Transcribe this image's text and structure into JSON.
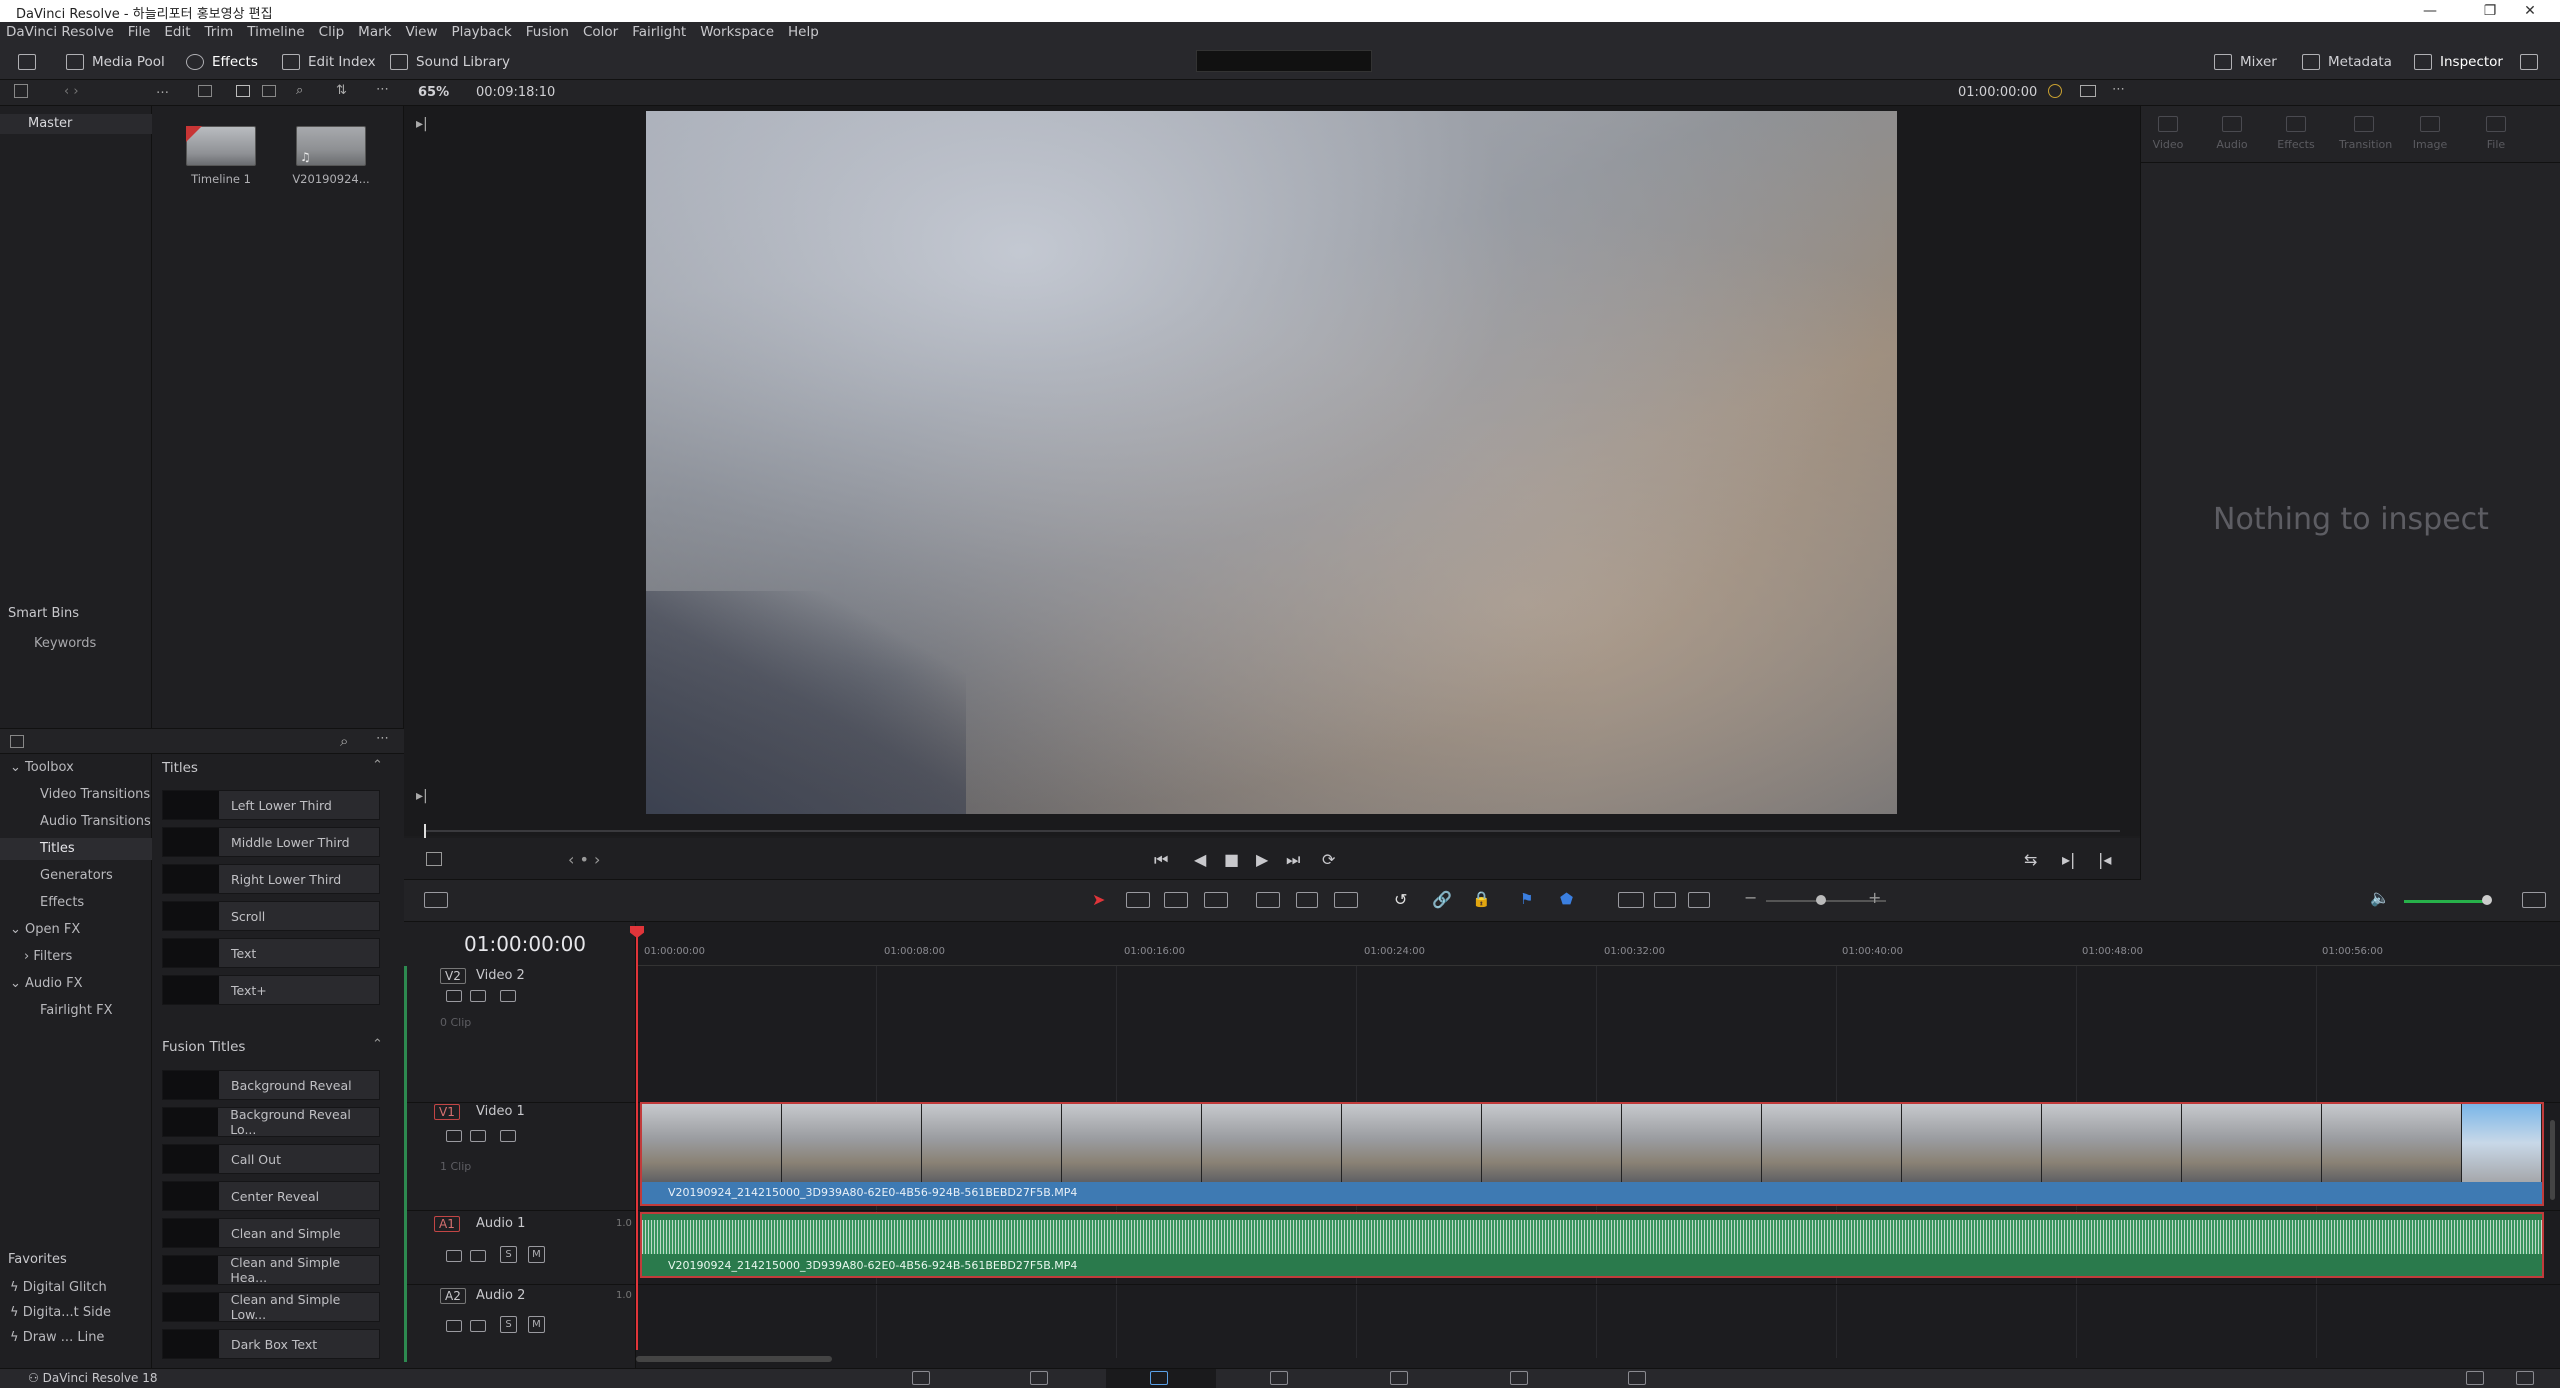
{
  "window": {
    "title": "DaVinci Resolve - 하늘리포터 홍보영상 편집",
    "minimize": "—",
    "maximize": "❐",
    "close": "✕"
  },
  "menu": [
    "DaVinci Resolve",
    "File",
    "Edit",
    "Trim",
    "Timeline",
    "Clip",
    "Mark",
    "View",
    "Playback",
    "Fusion",
    "Color",
    "Fairlight",
    "Workspace",
    "Help"
  ],
  "toolbar": {
    "media_pool": "Media Pool",
    "effects": "Effects",
    "edit_index": "Edit Index",
    "sound_library": "Sound Library",
    "mixer": "Mixer",
    "metadata": "Metadata",
    "inspector": "Inspector"
  },
  "subbar": {
    "zoom": "65%",
    "source_tc": "00:09:18:10",
    "record_tc": "01:00:00:00"
  },
  "bins": {
    "master": "Master",
    "smart_bins": "Smart Bins",
    "keywords": "Keywords"
  },
  "media": [
    {
      "label": "Timeline 1"
    },
    {
      "label": "V20190924..."
    }
  ],
  "effects_tree": {
    "toolbox": "Toolbox",
    "video_transitions": "Video Transitions",
    "audio_transitions": "Audio Transitions",
    "titles": "Titles",
    "generators": "Generators",
    "effects": "Effects",
    "open_fx": "Open FX",
    "filters": "Filters",
    "audio_fx": "Audio FX",
    "fairlight_fx": "Fairlight FX"
  },
  "titles_section": "Titles",
  "titles": [
    "Left Lower Third",
    "Middle Lower Third",
    "Right Lower Third",
    "Scroll",
    "Text",
    "Text+"
  ],
  "fusion_section": "Fusion Titles",
  "fusion_titles": [
    "Background Reveal",
    "Background Reveal Lo...",
    "Call Out",
    "Center Reveal",
    "Clean and Simple",
    "Clean and Simple Hea...",
    "Clean and Simple Low...",
    "Dark Box Text"
  ],
  "favorites": {
    "header": "Favorites",
    "items": [
      "Digital Glitch",
      "Digita...t Side",
      "Draw ... Line"
    ]
  },
  "inspector": {
    "tabs": [
      "Video",
      "Audio",
      "Effects",
      "Transition",
      "Image",
      "File"
    ],
    "empty_message": "Nothing to inspect"
  },
  "timeline": {
    "timecode": "01:00:00:00",
    "ruler": [
      "01:00:00:00",
      "01:00:08:00",
      "01:00:16:00",
      "01:00:24:00",
      "01:00:32:00",
      "01:00:40:00",
      "01:00:48:00",
      "01:00:56:00"
    ],
    "tracks": {
      "v2": {
        "badge": "V2",
        "name": "Video 2",
        "sub": "0 Clip"
      },
      "v1": {
        "badge": "V1",
        "name": "Video 1",
        "sub": "1 Clip"
      },
      "a1": {
        "badge": "A1",
        "name": "Audio 1",
        "level": "1.0"
      },
      "a2": {
        "badge": "A2",
        "name": "Audio 2",
        "level": "1.0"
      }
    },
    "clip_name": "V20190924_214215000_3D939A80-62E0-4B56-924B-561BEBD27F5B.MP4",
    "solo": "S",
    "mute": "M"
  },
  "footer": {
    "app_name": "DaVinci Resolve 18"
  }
}
